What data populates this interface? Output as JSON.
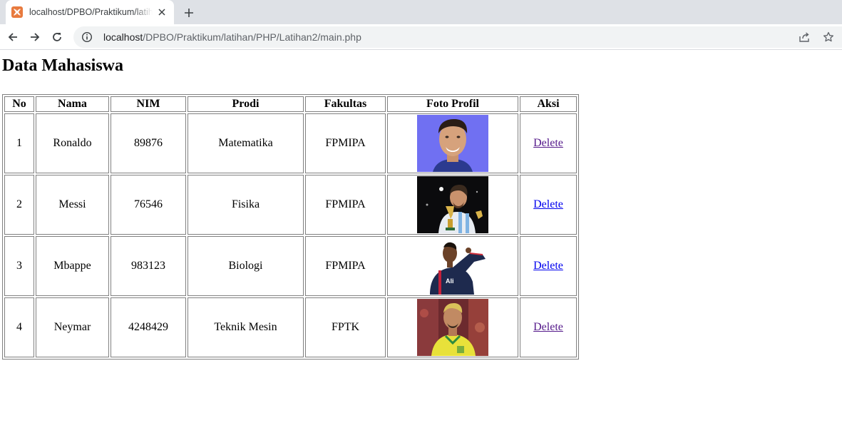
{
  "browser": {
    "tab": {
      "title": "localhost/DPBO/Praktikum/latihan/PHP/Latihan2/main.php"
    },
    "url": {
      "host": "localhost",
      "path": "/DPBO/Praktikum/latihan/PHP/Latihan2/main.php"
    }
  },
  "page": {
    "heading": "Data Mahasiswa",
    "table": {
      "headers": [
        "No",
        "Nama",
        "NIM",
        "Prodi",
        "Fakultas",
        "Foto Profil",
        "Aksi"
      ],
      "rows": [
        {
          "no": "1",
          "nama": "Ronaldo",
          "nim": "89876",
          "prodi": "Matematika",
          "fakultas": "FPMIPA",
          "foto": "portrait-photo",
          "aksi": "Delete",
          "visited": true
        },
        {
          "no": "2",
          "nama": "Messi",
          "nim": "76546",
          "prodi": "Fisika",
          "fakultas": "FPMIPA",
          "foto": "trophy-photo",
          "aksi": "Delete",
          "visited": false
        },
        {
          "no": "3",
          "nama": "Mbappe",
          "nim": "983123",
          "prodi": "Biologi",
          "fakultas": "FPMIPA",
          "foto": "jersey-photo",
          "aksi": "Delete",
          "visited": false
        },
        {
          "no": "4",
          "nama": "Neymar",
          "nim": "4248429",
          "prodi": "Teknik Mesin",
          "fakultas": "FPTK",
          "foto": "yellow-jersey-photo",
          "aksi": "Delete",
          "visited": true
        }
      ]
    }
  },
  "colors": {
    "link": "#0000ee",
    "link_visited": "#551a8b",
    "favicon": "#e87a3e"
  }
}
